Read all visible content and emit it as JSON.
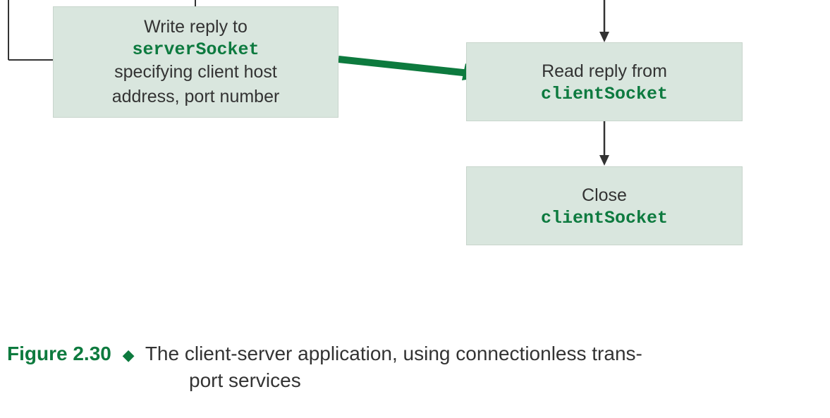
{
  "diagram": {
    "box1": {
      "line1": "Write reply to",
      "code": "serverSocket",
      "line2": "specifying client host",
      "line3": "address, port number"
    },
    "box2": {
      "line1": "Read reply from",
      "code": "clientSocket"
    },
    "box3": {
      "line1": "Close",
      "code": "clientSocket"
    }
  },
  "caption": {
    "label": "Figure 2.30",
    "text1": "The client-server application, using connectionless trans-",
    "text2": "port services"
  }
}
